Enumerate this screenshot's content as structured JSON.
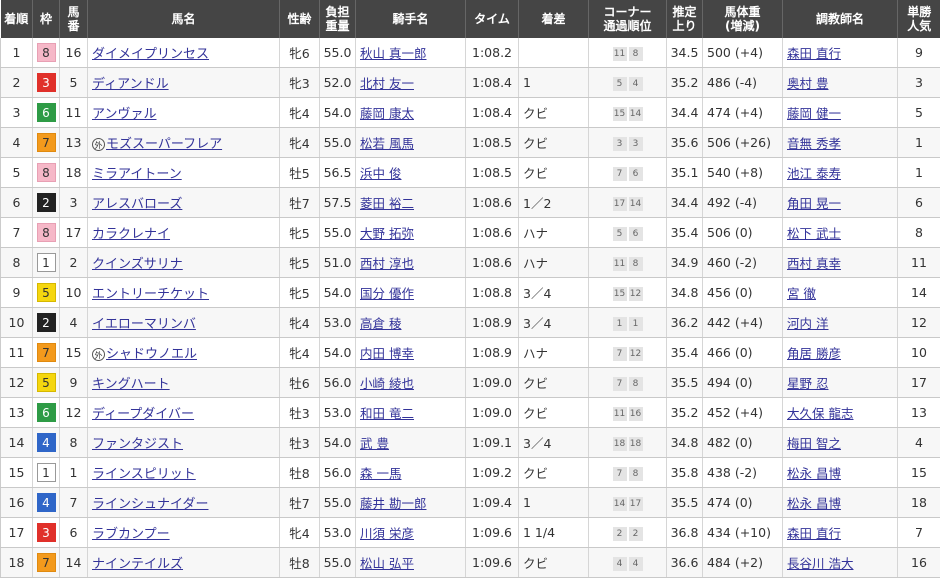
{
  "headers": [
    "着順",
    "枠",
    "馬番",
    "馬名",
    "性齢",
    "負担重量",
    "騎手名",
    "タイム",
    "着差",
    "コーナー通過順位",
    "推定上り",
    "馬体重(増減)",
    "調教師名",
    "単勝人気"
  ],
  "waku_colors": {
    "1": {
      "bg": "#ffffff",
      "fg": "#333333",
      "border": "#999999"
    },
    "2": {
      "bg": "#222222",
      "fg": "#ffffff",
      "border": "#222222"
    },
    "3": {
      "bg": "#e0302a",
      "fg": "#ffffff",
      "border": "#e0302a"
    },
    "4": {
      "bg": "#2f66c8",
      "fg": "#ffffff",
      "border": "#2f66c8"
    },
    "5": {
      "bg": "#f5d60f",
      "fg": "#333333",
      "border": "#d6b800"
    },
    "6": {
      "bg": "#2e9b46",
      "fg": "#ffffff",
      "border": "#2e9b46"
    },
    "7": {
      "bg": "#f39a1c",
      "fg": "#333333",
      "border": "#e08a10"
    },
    "8": {
      "bg": "#f6b8c8",
      "fg": "#333333",
      "border": "#e8a0b4"
    }
  },
  "rows": [
    {
      "rank": "1",
      "waku": "8",
      "umaban": "16",
      "mark": "",
      "horse": "ダイメイプリンセス",
      "sexage": "牝6",
      "weight": "55.0",
      "jockey": "秋山 真一郎",
      "time": "1:08.2",
      "margin": "",
      "corner": [
        "11",
        "8"
      ],
      "last3f": "34.5",
      "bodyweight": "500 (+4)",
      "trainer": "森田 直行",
      "pop": "9"
    },
    {
      "rank": "2",
      "waku": "3",
      "umaban": "5",
      "mark": "",
      "horse": "ディアンドル",
      "sexage": "牝3",
      "weight": "52.0",
      "jockey": "北村 友一",
      "time": "1:08.4",
      "margin": "1",
      "corner": [
        "5",
        "4"
      ],
      "last3f": "35.2",
      "bodyweight": "486 (-4)",
      "trainer": "奥村 豊",
      "pop": "3"
    },
    {
      "rank": "3",
      "waku": "6",
      "umaban": "11",
      "mark": "",
      "horse": "アンヴァル",
      "sexage": "牝4",
      "weight": "54.0",
      "jockey": "藤岡 康太",
      "time": "1:08.4",
      "margin": "クビ",
      "corner": [
        "15",
        "14"
      ],
      "last3f": "34.4",
      "bodyweight": "474 (+4)",
      "trainer": "藤岡 健一",
      "pop": "5"
    },
    {
      "rank": "4",
      "waku": "7",
      "umaban": "13",
      "mark": "外",
      "horse": "モズスーパーフレア",
      "sexage": "牝4",
      "weight": "55.0",
      "jockey": "松若 風馬",
      "time": "1:08.5",
      "margin": "クビ",
      "corner": [
        "3",
        "3"
      ],
      "last3f": "35.6",
      "bodyweight": "506 (+26)",
      "trainer": "音無 秀孝",
      "pop": "1"
    },
    {
      "rank": "5",
      "waku": "8",
      "umaban": "18",
      "mark": "",
      "horse": "ミラアイトーン",
      "sexage": "牡5",
      "weight": "56.5",
      "jockey": "浜中 俊",
      "time": "1:08.5",
      "margin": "クビ",
      "corner": [
        "7",
        "6"
      ],
      "last3f": "35.1",
      "bodyweight": "540 (+8)",
      "trainer": "池江 泰寿",
      "pop": "1"
    },
    {
      "rank": "6",
      "waku": "2",
      "umaban": "3",
      "mark": "",
      "horse": "アレスバローズ",
      "sexage": "牡7",
      "weight": "57.5",
      "jockey": "菱田 裕二",
      "time": "1:08.6",
      "margin": "1／2",
      "corner": [
        "17",
        "14"
      ],
      "last3f": "34.4",
      "bodyweight": "492 (-4)",
      "trainer": "角田 晃一",
      "pop": "6"
    },
    {
      "rank": "7",
      "waku": "8",
      "umaban": "17",
      "mark": "",
      "horse": "カラクレナイ",
      "sexage": "牝5",
      "weight": "55.0",
      "jockey": "大野 拓弥",
      "time": "1:08.6",
      "margin": "ハナ",
      "corner": [
        "5",
        "6"
      ],
      "last3f": "35.4",
      "bodyweight": "506 (0)",
      "trainer": "松下 武士",
      "pop": "8"
    },
    {
      "rank": "8",
      "waku": "1",
      "umaban": "2",
      "mark": "",
      "horse": "クインズサリナ",
      "sexage": "牝5",
      "weight": "51.0",
      "jockey": "西村 淳也",
      "time": "1:08.6",
      "margin": "ハナ",
      "corner": [
        "11",
        "8"
      ],
      "last3f": "34.9",
      "bodyweight": "460 (-2)",
      "trainer": "西村 真幸",
      "pop": "11"
    },
    {
      "rank": "9",
      "waku": "5",
      "umaban": "10",
      "mark": "",
      "horse": "エントリーチケット",
      "sexage": "牝5",
      "weight": "54.0",
      "jockey": "国分 優作",
      "time": "1:08.8",
      "margin": "3／4",
      "corner": [
        "15",
        "12"
      ],
      "last3f": "34.8",
      "bodyweight": "456 (0)",
      "trainer": "宮 徹",
      "pop": "14"
    },
    {
      "rank": "10",
      "waku": "2",
      "umaban": "4",
      "mark": "",
      "horse": "イエローマリンバ",
      "sexage": "牝4",
      "weight": "53.0",
      "jockey": "高倉 稜",
      "time": "1:08.9",
      "margin": "3／4",
      "corner": [
        "1",
        "1"
      ],
      "last3f": "36.2",
      "bodyweight": "442 (+4)",
      "trainer": "河内 洋",
      "pop": "12"
    },
    {
      "rank": "11",
      "waku": "7",
      "umaban": "15",
      "mark": "外",
      "horse": "シャドウノエル",
      "sexage": "牝4",
      "weight": "54.0",
      "jockey": "内田 博幸",
      "time": "1:08.9",
      "margin": "ハナ",
      "corner": [
        "7",
        "12"
      ],
      "last3f": "35.4",
      "bodyweight": "466 (0)",
      "trainer": "角居 勝彦",
      "pop": "10"
    },
    {
      "rank": "12",
      "waku": "5",
      "umaban": "9",
      "mark": "",
      "horse": "キングハート",
      "sexage": "牡6",
      "weight": "56.0",
      "jockey": "小崎 綾也",
      "time": "1:09.0",
      "margin": "クビ",
      "corner": [
        "7",
        "8"
      ],
      "last3f": "35.5",
      "bodyweight": "494 (0)",
      "trainer": "星野 忍",
      "pop": "17"
    },
    {
      "rank": "13",
      "waku": "6",
      "umaban": "12",
      "mark": "",
      "horse": "ディープダイバー",
      "sexage": "牡3",
      "weight": "53.0",
      "jockey": "和田 竜二",
      "time": "1:09.0",
      "margin": "クビ",
      "corner": [
        "11",
        "16"
      ],
      "last3f": "35.2",
      "bodyweight": "452 (+4)",
      "trainer": "大久保 龍志",
      "pop": "13"
    },
    {
      "rank": "14",
      "waku": "4",
      "umaban": "8",
      "mark": "",
      "horse": "ファンタジスト",
      "sexage": "牡3",
      "weight": "54.0",
      "jockey": "武 豊",
      "time": "1:09.1",
      "margin": "3／4",
      "corner": [
        "18",
        "18"
      ],
      "last3f": "34.8",
      "bodyweight": "482 (0)",
      "trainer": "梅田 智之",
      "pop": "4"
    },
    {
      "rank": "15",
      "waku": "1",
      "umaban": "1",
      "mark": "",
      "horse": "ラインスピリット",
      "sexage": "牡8",
      "weight": "56.0",
      "jockey": "森 一馬",
      "time": "1:09.2",
      "margin": "クビ",
      "corner": [
        "7",
        "8"
      ],
      "last3f": "35.8",
      "bodyweight": "438 (-2)",
      "trainer": "松永 昌博",
      "pop": "15"
    },
    {
      "rank": "16",
      "waku": "4",
      "umaban": "7",
      "mark": "",
      "horse": "ラインシュナイダー",
      "sexage": "牡7",
      "weight": "55.0",
      "jockey": "藤井 勘一郎",
      "time": "1:09.4",
      "margin": "1",
      "corner": [
        "14",
        "17"
      ],
      "last3f": "35.5",
      "bodyweight": "474 (0)",
      "trainer": "松永 昌博",
      "pop": "18"
    },
    {
      "rank": "17",
      "waku": "3",
      "umaban": "6",
      "mark": "",
      "horse": "ラブカンプー",
      "sexage": "牝4",
      "weight": "53.0",
      "jockey": "川須 栄彦",
      "time": "1:09.6",
      "margin": "1 1/4",
      "corner": [
        "2",
        "2"
      ],
      "last3f": "36.8",
      "bodyweight": "434 (+10)",
      "trainer": "森田 直行",
      "pop": "7"
    },
    {
      "rank": "18",
      "waku": "7",
      "umaban": "14",
      "mark": "",
      "horse": "ナインテイルズ",
      "sexage": "牡8",
      "weight": "55.0",
      "jockey": "松山 弘平",
      "time": "1:09.6",
      "margin": "クビ",
      "corner": [
        "4",
        "4"
      ],
      "last3f": "36.6",
      "bodyweight": "484 (+2)",
      "trainer": "長谷川 浩大",
      "pop": "16"
    }
  ]
}
